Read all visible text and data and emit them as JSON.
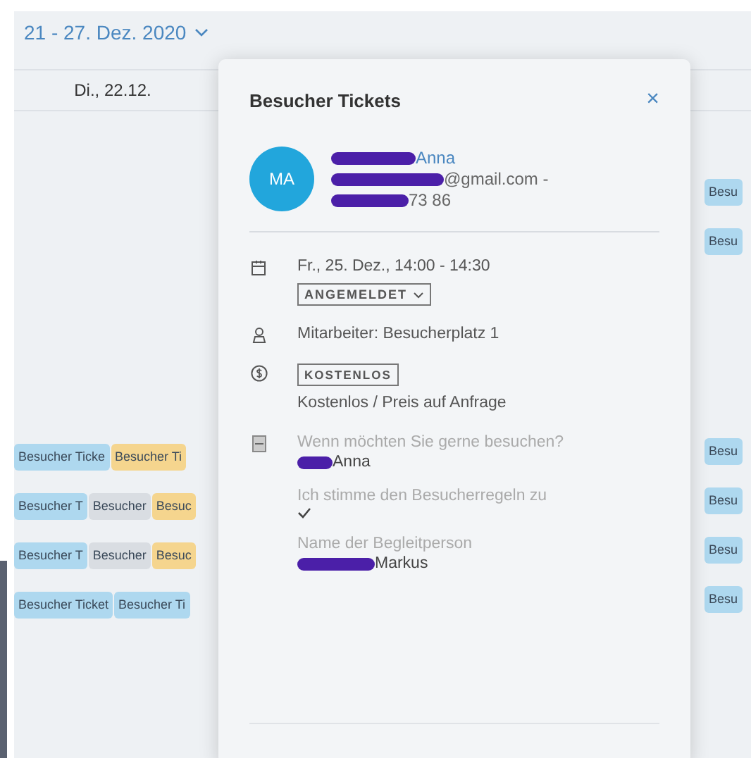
{
  "calendar": {
    "range": "21 - 27. Dez. 2020",
    "day_header": "Di., 22.12.",
    "left_rows": [
      [
        {
          "label": "Besucher Ticke",
          "color": "#aed8ef"
        },
        {
          "label": "Besucher Ti",
          "color": "#f5d58e"
        }
      ],
      [
        {
          "label": "Besucher T",
          "color": "#aed8ef"
        },
        {
          "label": "Besucher",
          "color": "#d9dde2"
        },
        {
          "label": "Besuc",
          "color": "#f5d58e"
        }
      ],
      [
        {
          "label": "Besucher T",
          "color": "#aed8ef"
        },
        {
          "label": "Besucher",
          "color": "#d9dde2"
        },
        {
          "label": "Besuc",
          "color": "#f5d58e"
        }
      ],
      [
        {
          "label": "Besucher Ticket",
          "color": "#aed8ef"
        },
        {
          "label": "Besucher Ti",
          "color": "#aed8ef"
        }
      ]
    ],
    "right_upper": [
      {
        "label": "Besu",
        "color": "#aed8ef"
      },
      {
        "label": "Besu",
        "color": "#aed8ef"
      }
    ],
    "right_lower": [
      {
        "label": "Besu",
        "color": "#aed8ef"
      },
      {
        "label": "Besu",
        "color": "#aed8ef"
      },
      {
        "label": "Besu",
        "color": "#aed8ef"
      },
      {
        "label": "Besu",
        "color": "#aed8ef"
      }
    ]
  },
  "popup": {
    "title": "Besucher Tickets",
    "close": "×",
    "contact": {
      "initials": "MA",
      "name": "Anna",
      "email": "@gmail.com -",
      "phone": "73 86"
    },
    "date": "Fr., 25. Dez., 14:00 - 14:30",
    "status": "ANGEMELDET",
    "staff": "Mitarbeiter: Besucherplatz 1",
    "price_badge": "KOSTENLOS",
    "price_text": "Kostenlos / Preis auf Anfrage",
    "answers": [
      {
        "kind": "text",
        "question": "Wenn möchten Sie gerne besuchen?",
        "answer": "Anna",
        "redacted": true
      },
      {
        "kind": "checkbox",
        "question": "Ich stimme den Besucherregeln zu",
        "checked": true
      },
      {
        "kind": "text",
        "question": "Name der Begleitperson",
        "answer": "Markus",
        "redacted": true
      }
    ]
  }
}
